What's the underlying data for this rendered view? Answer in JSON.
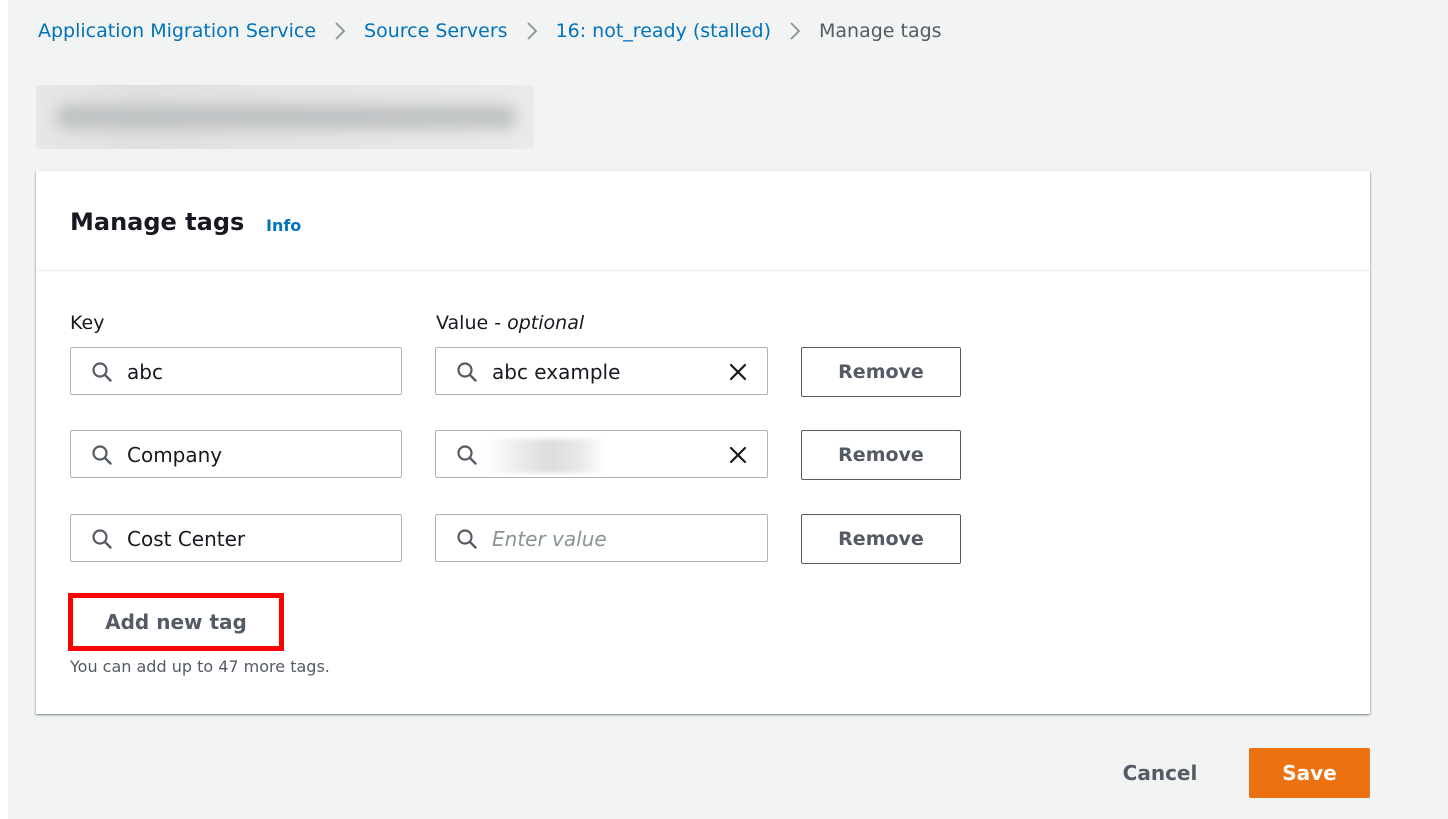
{
  "breadcrumb": {
    "items": [
      {
        "label": "Application Migration Service"
      },
      {
        "label": "Source Servers"
      },
      {
        "label": "16: not_ready (stalled)"
      }
    ],
    "current": "Manage tags"
  },
  "panel": {
    "title": "Manage tags",
    "info_label": "Info",
    "key_label": "Key",
    "value_label": "Value - ",
    "value_label_suffix": "optional",
    "tags": [
      {
        "key": "abc",
        "value": "abc example"
      },
      {
        "key": "Company",
        "value": ""
      },
      {
        "key": "Cost Center",
        "value": "",
        "value_placeholder": "Enter value"
      }
    ],
    "remove_label": "Remove",
    "add_tag_label": "Add new tag",
    "hint": "You can add up to 47 more tags."
  },
  "footer": {
    "cancel_label": "Cancel",
    "save_label": "Save"
  },
  "colors": {
    "link": "#0073bb",
    "primary_button": "#ec7211",
    "highlight_box": "#ff0000",
    "page_background": "#f2f3f3"
  },
  "icons": {
    "separator": "chevron-right-icon",
    "field_search": "search-icon",
    "field_clear": "close-icon"
  }
}
